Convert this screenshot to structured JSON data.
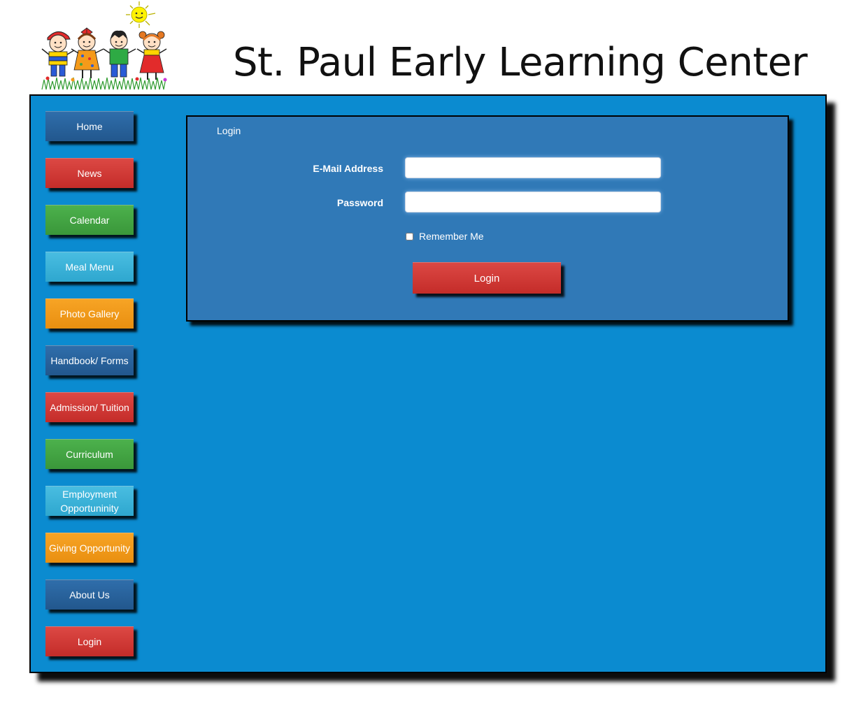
{
  "site": {
    "title": "St. Paul Early Learning Center"
  },
  "nav": {
    "items": [
      {
        "label": "Home",
        "color": "#2a64a0"
      },
      {
        "label": "News",
        "color": "#d23a37"
      },
      {
        "label": "Calendar",
        "color": "#43a543"
      },
      {
        "label": "Meal Menu",
        "color": "#3cb3da"
      },
      {
        "label": "Photo Gallery",
        "color": "#f09a1a"
      },
      {
        "label": "Handbook/ Forms",
        "color": "#2a64a0"
      },
      {
        "label": "Admission/ Tuition",
        "color": "#d23a37"
      },
      {
        "label": "Curriculum",
        "color": "#43a543"
      },
      {
        "label": "Employment",
        "label2": "Opportuninity",
        "color": "#3cb3da"
      },
      {
        "label": "Giving Opportunity",
        "color": "#f09a1a"
      },
      {
        "label": "About Us",
        "color": "#2a64a0"
      },
      {
        "label": "Login",
        "color": "#d23a37"
      }
    ]
  },
  "login_form": {
    "heading": "Login",
    "email_label": "E-Mail Address",
    "email_value": "",
    "password_label": "Password",
    "password_value": "",
    "remember_label": "Remember Me",
    "submit_label": "Login"
  },
  "colors": {
    "panel": "#0b8bd0",
    "form_box": "#3079b7"
  }
}
